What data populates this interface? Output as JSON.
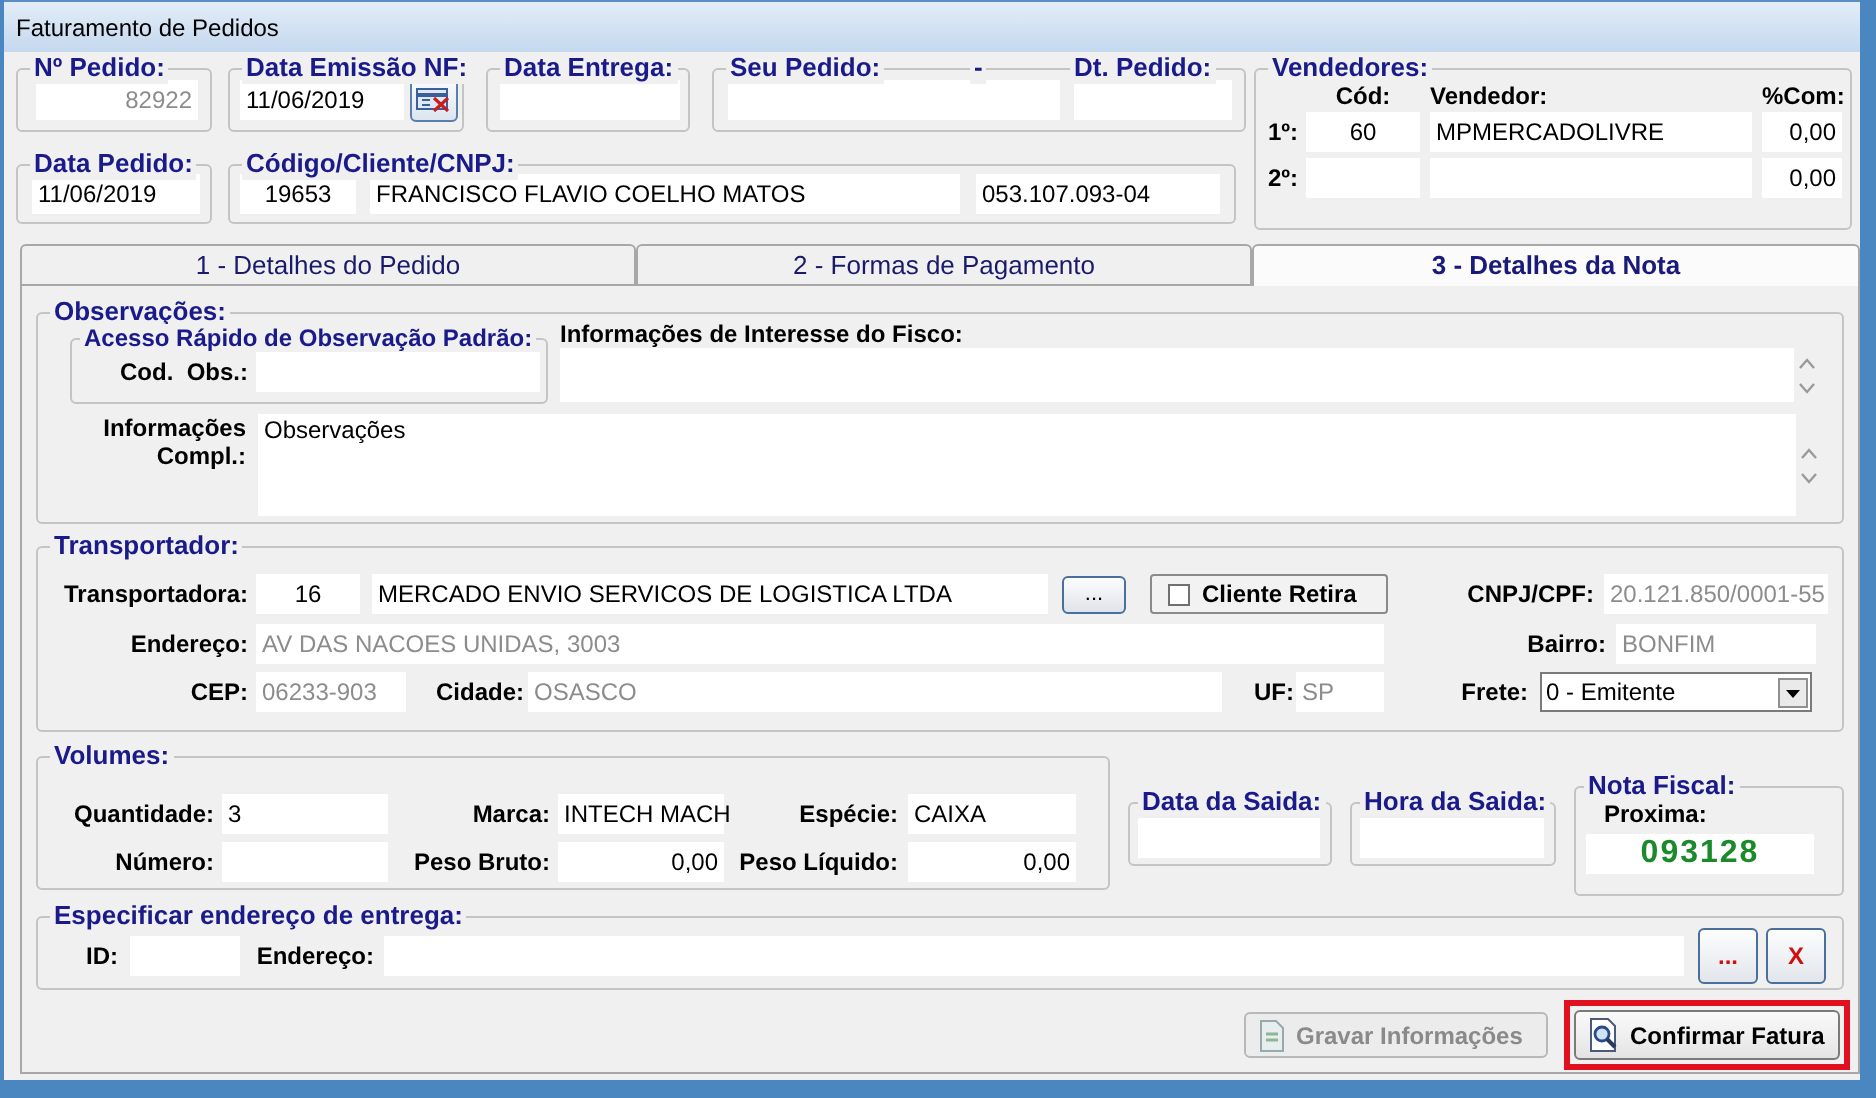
{
  "window": {
    "title": "Faturamento de Pedidos"
  },
  "pedido": {
    "label": "Nº Pedido:",
    "value": "82922",
    "disabled": true
  },
  "data_emissao": {
    "label": "Data Emissão NF:",
    "value": "11/06/2019"
  },
  "data_entrega": {
    "label": "Data Entrega:"
  },
  "seu_pedido": {
    "label": "Seu Pedido:",
    "separator": "-",
    "dt_label": "Dt. Pedido:"
  },
  "data_pedido": {
    "label": "Data Pedido:",
    "value": "11/06/2019"
  },
  "cliente": {
    "label": "Código/Cliente/CNPJ:",
    "code": "19653",
    "name": "FRANCISCO FLAVIO COELHO MATOS",
    "cnpj": "053.107.093-04"
  },
  "vendedores": {
    "label": "Vendedores:",
    "columns": [
      "Cód:",
      "Vendedor:",
      "%Com:"
    ],
    "rows": [
      {
        "rank": "1º:",
        "code": "60",
        "name": "MPMERCADOLIVRE",
        "commission": "0,00"
      },
      {
        "rank": "2º:",
        "commission": "0,00"
      }
    ]
  },
  "tabs": [
    {
      "label": "1 - Detalhes do Pedido",
      "selected": false
    },
    {
      "label": "2 - Formas de Pagamento",
      "selected": false
    },
    {
      "label": "3 - Detalhes da Nota",
      "selected": true
    }
  ],
  "observacoes": {
    "label": "Observações:",
    "quick_label": "Acesso Rápido de Observação Padrão:",
    "cod_label": "Cod.  Obs.:",
    "fisco_label": "Informações de Interesse do Fisco:",
    "compl_label": "Informações Compl.:",
    "compl_value": "Observações"
  },
  "transportador": {
    "label": "Transportador:",
    "transportadora_label": "Transportadora:",
    "code": "16",
    "name": "MERCADO ENVIO SERVICOS DE LOGISTICA LTDA",
    "browse": "...",
    "cliente_retira": {
      "label": "Cliente Retira",
      "checked": false
    },
    "cnpj_label": "CNPJ/CPF:",
    "cnpj": {
      "value": "20.121.850/0001-55",
      "disabled": true
    },
    "endereco_label": "Endereço:",
    "endereco": {
      "value": "AV DAS NACOES UNIDAS, 3003",
      "disabled": true
    },
    "bairro_label": "Bairro:",
    "bairro": {
      "value": "BONFIM",
      "disabled": true
    },
    "cep_label": "CEP:",
    "cep": {
      "value": "06233-903",
      "disabled": true
    },
    "cidade_label": "Cidade:",
    "cidade": {
      "value": "OSASCO",
      "disabled": true
    },
    "uf_label": "UF:",
    "uf": {
      "value": "SP",
      "disabled": true
    },
    "frete_label": "Frete:",
    "frete": "0 - Emitente"
  },
  "volumes": {
    "label": "Volumes:",
    "quantidade_label": "Quantidade:",
    "quantidade": "3",
    "marca_label": "Marca:",
    "marca": "INTECH MACH",
    "especie_label": "Espécie:",
    "especie": "CAIXA",
    "numero_label": "Número:",
    "peso_bruto_label": "Peso Bruto:",
    "peso_bruto": "0,00",
    "peso_liquido_label": "Peso Líquido:",
    "peso_liquido": "0,00"
  },
  "data_saida": {
    "label": "Data da Saida:"
  },
  "hora_saida": {
    "label": "Hora da Saida:"
  },
  "nota_fiscal": {
    "label": "Nota Fiscal:",
    "proxima_label": "Proxima:",
    "value": "093128"
  },
  "entrega": {
    "label": "Especificar endereço de entrega:",
    "id_label": "ID:",
    "endereco_label": "Endereço:",
    "browse": "...",
    "clear": "X"
  },
  "buttons": [
    {
      "label": "Gravar Informações",
      "disabled": true,
      "highlighted": false
    },
    {
      "label": "Confirmar Fatura",
      "disabled": false,
      "highlighted": true
    }
  ]
}
